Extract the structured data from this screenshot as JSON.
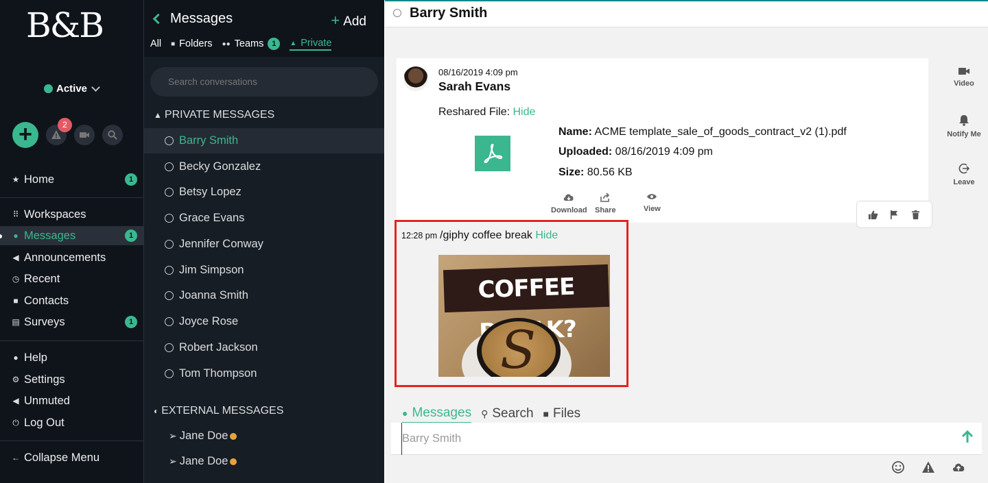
{
  "app": {
    "logo_text": "B&B"
  },
  "nav": {
    "status": "Active",
    "alerts_badge": "2",
    "items": [
      {
        "label": "Home",
        "badge": "1"
      },
      {
        "label": "Workspaces"
      },
      {
        "label": "Messages",
        "badge": "1"
      },
      {
        "label": "Announcements"
      },
      {
        "label": "Recent"
      },
      {
        "label": "Contacts"
      },
      {
        "label": "Surveys",
        "badge": "1"
      },
      {
        "label": "Help"
      },
      {
        "label": "Settings"
      },
      {
        "label": "Unmuted"
      },
      {
        "label": "Log Out"
      },
      {
        "label": "Collapse Menu"
      }
    ]
  },
  "list": {
    "title": "Messages",
    "add_label": "Add",
    "tabs": [
      {
        "label": "All"
      },
      {
        "label": "Folders"
      },
      {
        "label": "Teams",
        "badge": "1"
      },
      {
        "label": "Private"
      }
    ],
    "search_placeholder": "Search conversations",
    "private_header": "PRIVATE MESSAGES",
    "private": [
      "Barry Smith",
      "Becky Gonzalez",
      "Betsy Lopez",
      "Grace Evans",
      "Jennifer Conway",
      "Jim Simpson",
      "Joanna Smith",
      "Joyce Rose",
      "Robert Jackson",
      "Tom Thompson"
    ],
    "external_header": "EXTERNAL MESSAGES",
    "external": [
      "Jane Doe",
      "Jane Doe"
    ]
  },
  "chat": {
    "title": "Barry Smith",
    "message": {
      "date": "08/16/2019 4:09 pm",
      "author": "Sarah Evans",
      "reshared_label": "Reshared File:",
      "hide_label": "Hide",
      "file": {
        "name_label": "Name:",
        "name": "ACME template_sale_of_goods_contract_v2 (1).pdf",
        "uploaded_label": "Uploaded:",
        "uploaded": "08/16/2019 4:09 pm",
        "size_label": "Size:",
        "size": "80.56 KB"
      },
      "actions": {
        "download": "Download",
        "share": "Share",
        "view": "View"
      }
    },
    "giphy": {
      "time": "12:28 pm",
      "text": "/giphy coffee break",
      "hide_label": "Hide",
      "image_text": "COFFEE BREAK?"
    },
    "side_actions": {
      "video": "Video",
      "notify": "Notify Me",
      "leave": "Leave"
    },
    "bottom_tabs": [
      {
        "label": "Messages"
      },
      {
        "label": "Search"
      },
      {
        "label": "Files"
      }
    ],
    "composer_placeholder": "Barry Smith"
  },
  "colors": {
    "accent": "#3bb78f",
    "nav_bg": "#0f141b",
    "list_bg": "#161d25",
    "badge_red": "#e45a64",
    "highlight": "#e0261e"
  }
}
